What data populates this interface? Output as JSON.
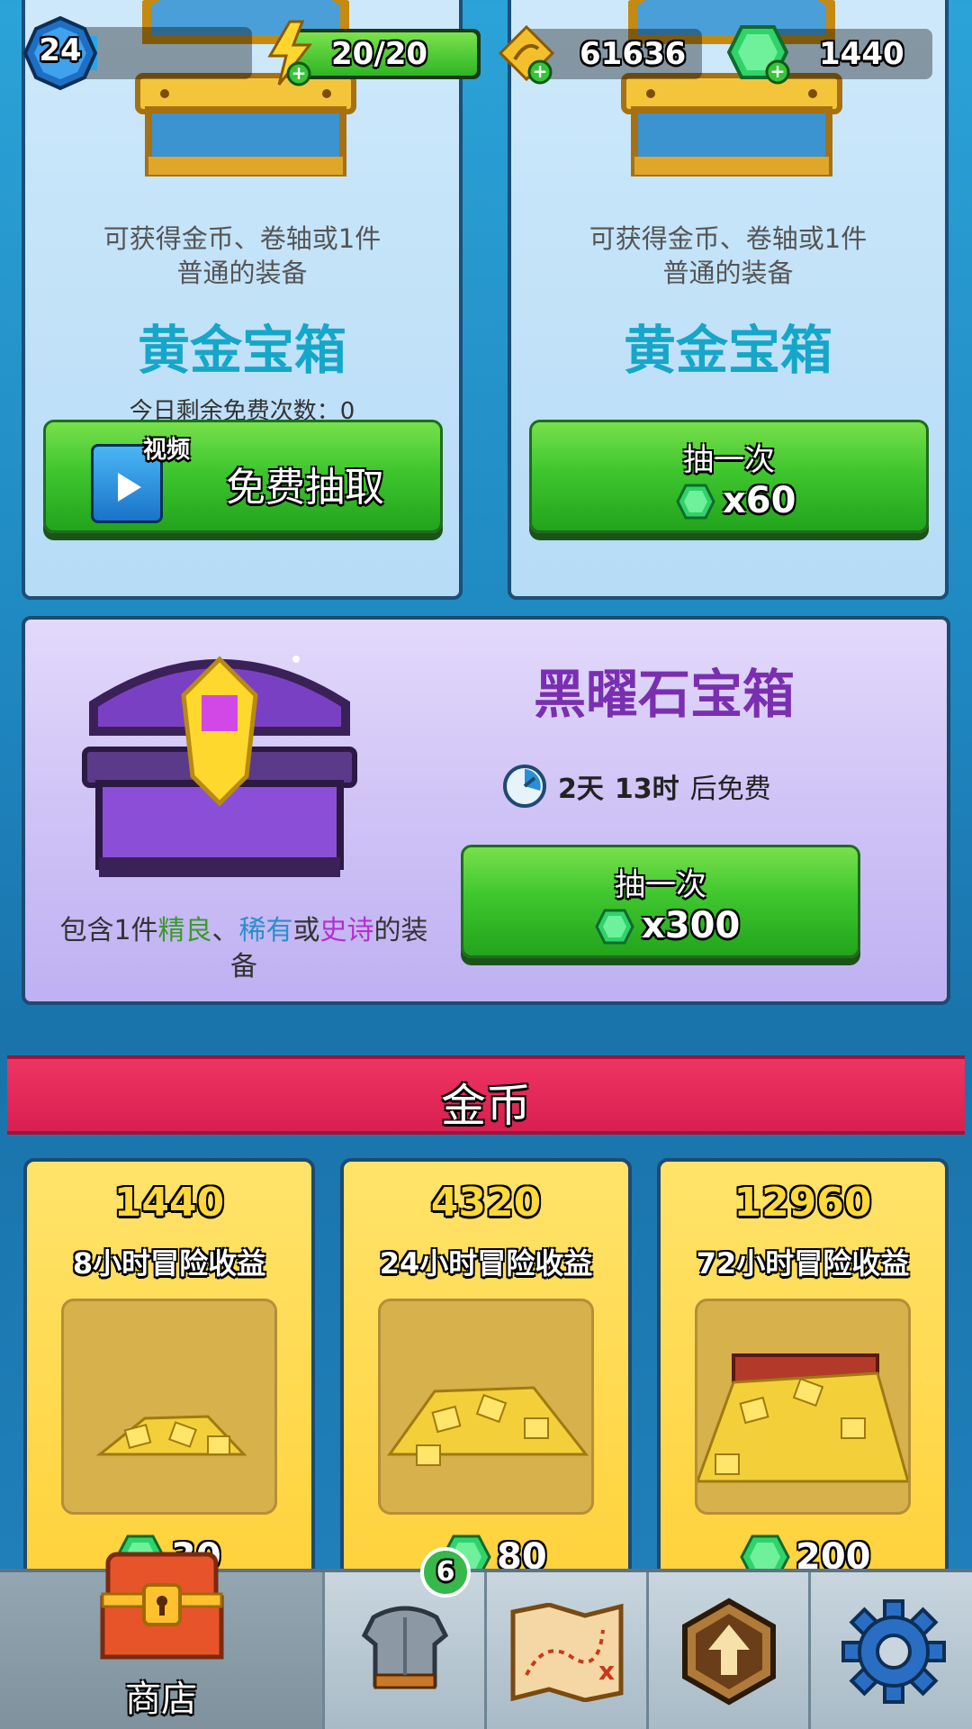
{
  "hud": {
    "level": "24",
    "energy": "20/20",
    "scrolls": "61636",
    "gems": "1440"
  },
  "gold_chest_free": {
    "description_line1": "可获得金币、卷轴或1件",
    "description_line2": "普通的装备",
    "title": "黄金宝箱",
    "free_remaining": "今日剩余免费次数：0",
    "video_badge": "视频",
    "button_label": "免费抽取"
  },
  "gold_chest_paid": {
    "description_line1": "可获得金币、卷轴或1件",
    "description_line2": "普通的装备",
    "title": "黄金宝箱",
    "button_label": "抽一次",
    "cost": "x60"
  },
  "obsidian_chest": {
    "title": "黑曜石宝箱",
    "timer_days": "2天",
    "timer_hours": "13时",
    "timer_suffix": "后免费",
    "button_label": "抽一次",
    "cost": "x300",
    "desc_prefix": "包含1件",
    "desc_fine": "精良",
    "desc_sep": "、",
    "desc_rare": "稀有",
    "desc_or": "或",
    "desc_epic": "史诗",
    "desc_suffix": "的装",
    "desc_line2": "备"
  },
  "gold_section": {
    "banner": "金币",
    "offers": [
      {
        "amount": "1440",
        "label": "8小时冒险收益",
        "price": "30"
      },
      {
        "amount": "4320",
        "label": "24小时冒险收益",
        "price": "80"
      },
      {
        "amount": "12960",
        "label": "72小时冒险收益",
        "price": "200"
      }
    ]
  },
  "nav": {
    "shop_label": "商店",
    "equipment_badge": "6"
  },
  "colors": {
    "green": "#3fc62e",
    "gem": "#2fd36a",
    "banner": "#e62a5a",
    "title_teal": "#16a6c9",
    "title_purple": "#7a2fb0"
  }
}
